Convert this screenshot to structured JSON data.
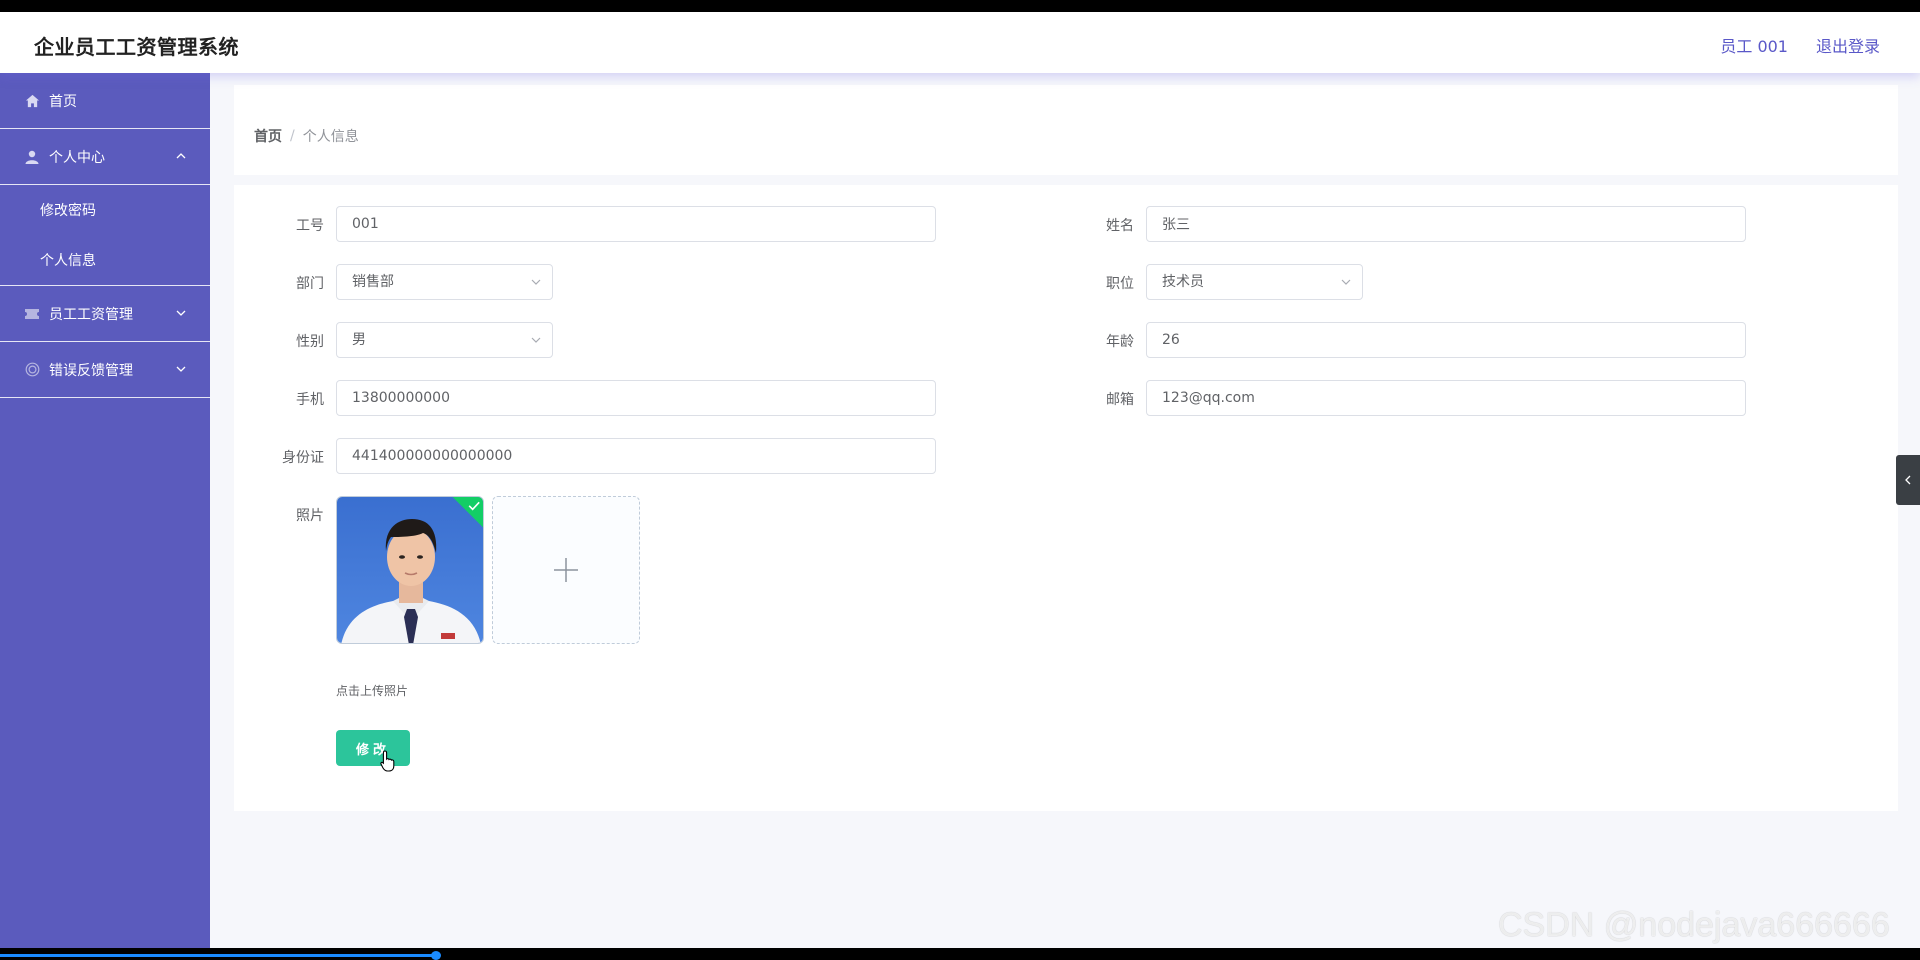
{
  "header": {
    "title": "企业员工工资管理系统",
    "user": "员工 001",
    "logout": "退出登录"
  },
  "sidebar": {
    "home": "首页",
    "personal_center": "个人中心",
    "sub_items": [
      "修改密码",
      "个人信息"
    ],
    "salary_mgmt": "员工工资管理",
    "feedback_mgmt": "错误反馈管理"
  },
  "breadcrumb": {
    "home": "首页",
    "separator": "/",
    "current": "个人信息"
  },
  "form": {
    "employee_no": {
      "label": "工号",
      "value": "001"
    },
    "name": {
      "label": "姓名",
      "value": "张三"
    },
    "department": {
      "label": "部门",
      "value": "销售部"
    },
    "position": {
      "label": "职位",
      "value": "技术员"
    },
    "gender": {
      "label": "性别",
      "value": "男"
    },
    "age": {
      "label": "年龄",
      "value": "26"
    },
    "phone": {
      "label": "手机",
      "value": "13800000000"
    },
    "email": {
      "label": "邮箱",
      "value": "123@qq.com"
    },
    "id_card": {
      "label": "身份证",
      "value": "441400000000000000"
    },
    "photo": {
      "label": "照片"
    },
    "upload_tip": "点击上传照片",
    "submit": "修改"
  },
  "watermark": "CSDN @nodejava666666",
  "colors": {
    "sidebar": "#5b5bbd",
    "header_text_accent": "#5a58c8",
    "primary_button": "#2cc59b",
    "upload_success": "#13ce66"
  },
  "video_progress": 0.227
}
